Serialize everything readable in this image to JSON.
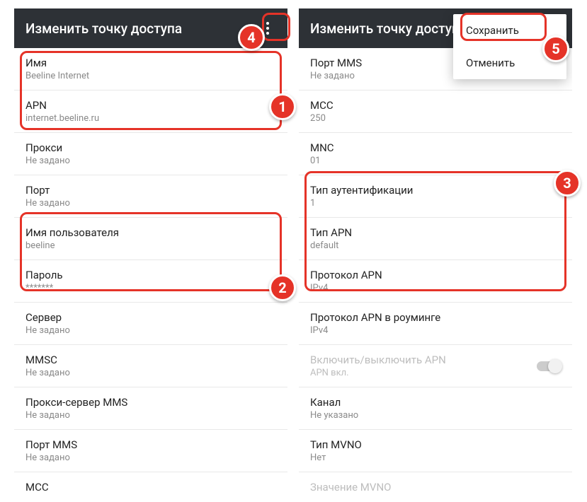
{
  "left": {
    "title": "Изменить точку доступа",
    "rows": [
      {
        "label": "Имя",
        "value": "Beeline Internet"
      },
      {
        "label": "APN",
        "value": "internet.beeline.ru"
      },
      {
        "label": "Прокси",
        "value": "Не задано"
      },
      {
        "label": "Порт",
        "value": "Не задано"
      },
      {
        "label": "Имя пользователя",
        "value": "beeline"
      },
      {
        "label": "Пароль",
        "value": "*******"
      },
      {
        "label": "Сервер",
        "value": "Не задано"
      },
      {
        "label": "MMSC",
        "value": "Не задано"
      },
      {
        "label": "Прокси-сервер MMS",
        "value": "Не задано"
      },
      {
        "label": "Порт MMS",
        "value": "Не задано"
      },
      {
        "label": "MCC",
        "value": ""
      }
    ]
  },
  "right": {
    "title": "Изменить точку доступа",
    "menu": {
      "save": "Сохранить",
      "cancel": "Отменить"
    },
    "rows": [
      {
        "label": "Порт MMS",
        "value": "Не задано"
      },
      {
        "label": "MCC",
        "value": "250"
      },
      {
        "label": "MNC",
        "value": "01"
      },
      {
        "label": "Тип аутентификации",
        "value": "1"
      },
      {
        "label": "Тип APN",
        "value": "default"
      },
      {
        "label": "Протокол APN",
        "value": "IPv4"
      },
      {
        "label": "Протокол APN в роуминге",
        "value": "IPv4"
      },
      {
        "label": "Включить/выключить APN",
        "value": "APN вкл.",
        "switch": true,
        "disabled": true
      },
      {
        "label": "Канал",
        "value": "Не указано"
      },
      {
        "label": "Тип MVNO",
        "value": "Нет"
      },
      {
        "label": "Значение MVNO",
        "value": "",
        "disabled": true
      }
    ]
  },
  "badges": {
    "b1": "1",
    "b2": "2",
    "b3": "3",
    "b4": "4",
    "b5": "5"
  }
}
